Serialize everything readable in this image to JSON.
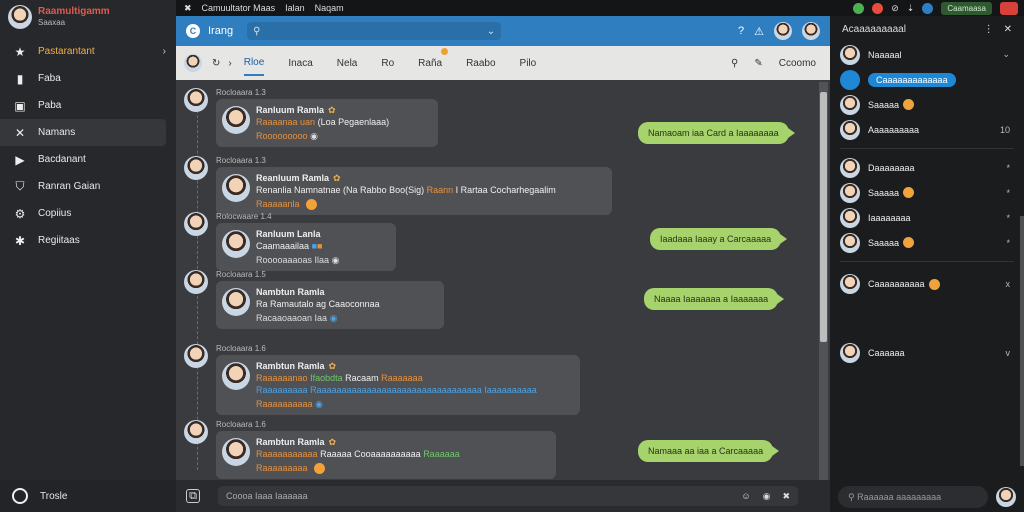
{
  "app": {
    "title": "Raamultigamm",
    "subtitle": "Saaxaa"
  },
  "sysbar": {
    "title": "Camuultator Maas",
    "item1": "Ialan",
    "item2": "Naqam",
    "right_pill": "Caamaasa",
    "accent": "#2f7fc0"
  },
  "nav": {
    "items": [
      {
        "label": "Pastarantant",
        "icon": "star-icon"
      },
      {
        "label": "Faba",
        "icon": "bookmark-icon"
      },
      {
        "label": "Paba",
        "icon": "shopping-bag-icon"
      },
      {
        "label": "Namans",
        "icon": "close-square-icon"
      },
      {
        "label": "Bacdanant",
        "icon": "play-icon"
      },
      {
        "label": "Ranran Gaian",
        "icon": "shield-icon"
      },
      {
        "label": "Copiius",
        "icon": "gear-icon"
      },
      {
        "label": "Regiitaas",
        "icon": "star-outline-icon"
      }
    ],
    "bottom": "Trosle"
  },
  "search": {
    "title": "Irang",
    "placeholder": ""
  },
  "tabs": [
    {
      "label": "Rloe"
    },
    {
      "label": "Inaca"
    },
    {
      "label": "Nela"
    },
    {
      "label": "Ro"
    },
    {
      "label": "Raña"
    },
    {
      "label": "Raabo"
    },
    {
      "label": "Pilo"
    }
  ],
  "tabs_right": {
    "label": "Ccoomo"
  },
  "messages": [
    {
      "meta": "Rocloaara 1.3",
      "name": "Ranluum Ramla",
      "line1": "Raaaanaa uan",
      "line2": "(Loa Pegaenlaaa)",
      "foot": "Rooooooooo"
    },
    {
      "meta": "Rocloaara 1.3",
      "name": "Reanluum Ramla",
      "line1": "Renanlia Namnatnae (Na Rabbo Boo(Sig)",
      "line2": "Raann",
      "line3": "I Rartaa Cocharhegaalim",
      "foot": "Raaaaanla"
    },
    {
      "meta": "Rolocwaare 1.4",
      "name": "Ranluum Lanla",
      "line1": "Caamaaailaa",
      "foot": "Rooooaaaoas Ilaa"
    },
    {
      "meta": "Rocloaara 1.5",
      "name": "Nambtun Ramla",
      "line1": "Ra Ramautalo ag",
      "line2": "Caaoconnaa",
      "foot": "Racaaoaaoan Iaa"
    },
    {
      "meta": "Rocloaara 1.6",
      "name": "Rambtun Ramla",
      "line1": "Raaaaaanao",
      "line2": "Ifaobdta",
      "line3": "Racaam",
      "line4": "Raaaaaaa",
      "line5": "Raaaaaaaaa",
      "line6": "Raaaaaaaaaaaaaaaaaaaaaaaaaaaaaaaaa Iaaaaaaaaaa",
      "foot": "Raaaaaaaaaa"
    },
    {
      "meta": "Rocloaara 1.6",
      "name": "Rambtun Ramla",
      "line1": "Raaaaaaaaaaa",
      "line2": "Raaaaa Cooaaaaaaaaaa",
      "line3": "Raaaaaa",
      "foot": "Raaaaaaaaa"
    }
  ],
  "outgoing": [
    {
      "text": "Namaoam iaa Card a Iaaaaaaaa"
    },
    {
      "text": "Iaadaaa Iaaay a Carcaaaaa"
    },
    {
      "text": "Naaaa Iaaaaaaa a Iaaaaaaa"
    },
    {
      "text": "Namaaa aa iaa a Carcaaaaa"
    }
  ],
  "composer": {
    "placeholder": "Coooa Iaaa Iaaaaaa"
  },
  "right_panel": {
    "header": "Acaaaaaaaaal",
    "items": [
      {
        "label": "Naaaaal",
        "trail": "v"
      },
      {
        "label": "Caaaaaaaaaaaaa",
        "selected": true
      },
      {
        "label": "Saaaaa"
      },
      {
        "label": "Aaaaaaaaaa",
        "trail": "10"
      },
      {
        "label": "Daaaaaaaa",
        "trail": "*"
      },
      {
        "label": "Saaaaa",
        "trail": "*"
      },
      {
        "label": "Iaaaaaaaa",
        "trail": "*"
      },
      {
        "label": "Saaaaa",
        "trail": "*"
      },
      {
        "label": "Caaaaaaaaaa",
        "trail": "x"
      },
      {
        "label": "Caaaaaa",
        "trail": "v"
      }
    ],
    "search": "Raaaaaa aaaaaaaaa"
  }
}
